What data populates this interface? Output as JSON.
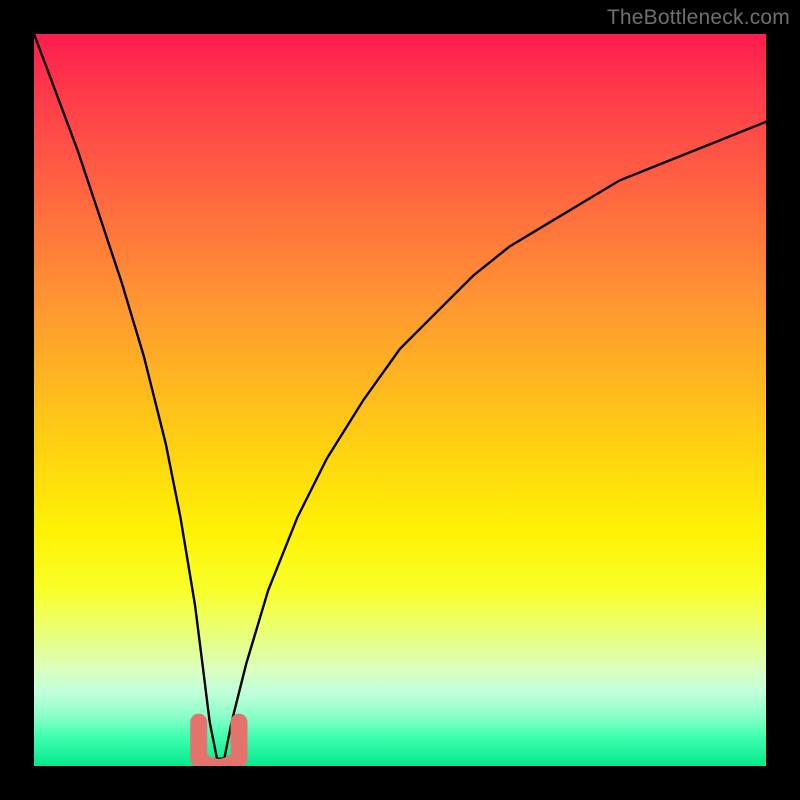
{
  "watermark": "TheBottleneck.com",
  "colors": {
    "page_bg": "#000000",
    "watermark": "#6f6f6f",
    "curve_stroke": "#000000",
    "tip_stroke": "#e3736c",
    "gradient_stops": [
      "#ff1c4e",
      "#ff3a4a",
      "#ff5a44",
      "#ff7a3a",
      "#ff9a30",
      "#ffb81f",
      "#ffd60f",
      "#fff205",
      "#f8ff2a",
      "#e9ff7a",
      "#d9ffc0",
      "#bfffdc",
      "#8effc8",
      "#3fffb0",
      "#06e88b"
    ]
  },
  "chart_data": {
    "type": "line",
    "title": "",
    "xlabel": "",
    "ylabel": "",
    "xlim": [
      0,
      100
    ],
    "ylim": [
      0,
      100
    ],
    "grid": false,
    "legend": false,
    "note": "V-shaped bottleneck curve; y ≈ 0 near x ≈ 25, rising steeply on both sides. Values below are visual estimates from the figure.",
    "series": [
      {
        "name": "bottleneck-curve",
        "x": [
          0,
          3,
          6,
          9,
          12,
          15,
          18,
          20,
          22,
          23,
          24,
          25,
          26,
          27,
          29,
          32,
          36,
          40,
          45,
          50,
          55,
          60,
          65,
          70,
          75,
          80,
          85,
          90,
          95,
          100
        ],
        "y": [
          100,
          92,
          84,
          75,
          66,
          56,
          44,
          34,
          22,
          14,
          6,
          1,
          1,
          6,
          14,
          24,
          34,
          42,
          50,
          57,
          62,
          67,
          71,
          74,
          77,
          80,
          82,
          84,
          86,
          88
        ]
      }
    ],
    "tip_region": {
      "x_range": [
        22.5,
        28.0
      ],
      "y_range": [
        0,
        6
      ],
      "description": "Thick salmon U-shaped marker at valley of the curve"
    }
  }
}
